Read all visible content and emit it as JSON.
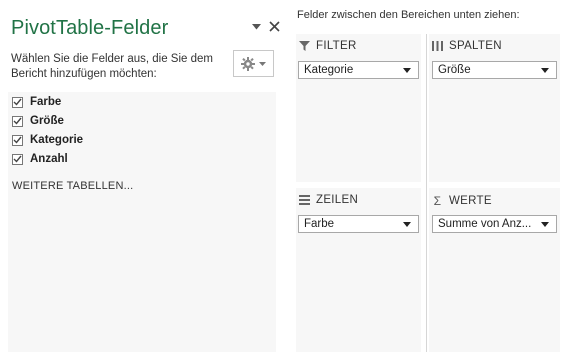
{
  "pane": {
    "title": "PivotTable-Felder",
    "description": "Wählen Sie die Felder aus, die Sie dem Bericht hinzufügen möchten:",
    "fields": [
      {
        "label": "Farbe",
        "checked": true
      },
      {
        "label": "Größe",
        "checked": true
      },
      {
        "label": "Kategorie",
        "checked": true
      },
      {
        "label": "Anzahl",
        "checked": true
      }
    ],
    "more_tables": "WEITERE TABELLEN..."
  },
  "areas": {
    "instruction": "Felder zwischen den Bereichen unten ziehen:",
    "filter": {
      "label": "FILTER",
      "value": "Kategorie",
      "icon": "filter-icon"
    },
    "columns": {
      "label": "SPALTEN",
      "value": "Größe",
      "icon": "columns-icon"
    },
    "rows": {
      "label": "ZEILEN",
      "value": "Farbe",
      "icon": "rows-icon"
    },
    "values": {
      "label": "WERTE",
      "value": "Summe von Anz...",
      "icon": "sigma-icon"
    }
  },
  "colors": {
    "title": "#217346",
    "panel": "#f7f7f7",
    "border": "#a8a8a8"
  }
}
